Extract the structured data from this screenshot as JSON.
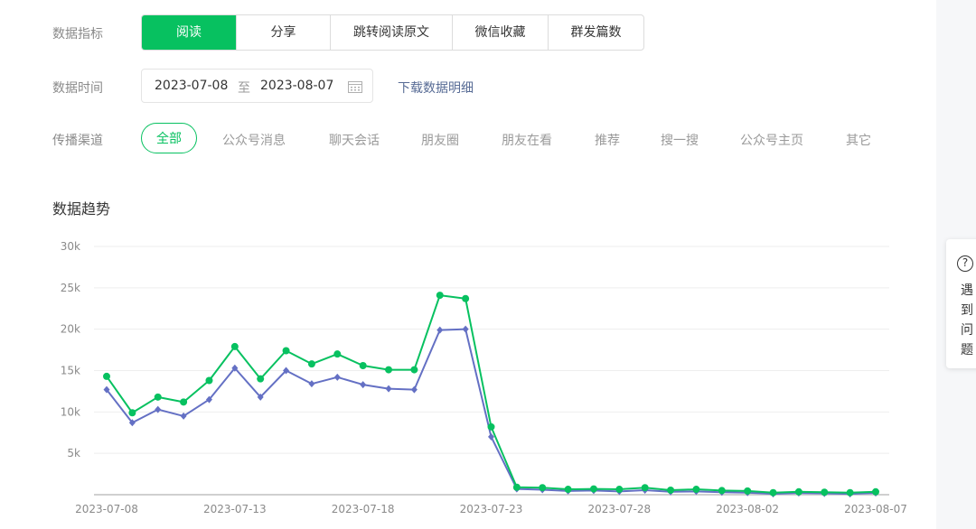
{
  "filters": {
    "metric_label": "数据指标",
    "metrics": [
      "阅读",
      "分享",
      "跳转阅读原文",
      "微信收藏",
      "群发篇数"
    ],
    "active_metric": "阅读",
    "time_label": "数据时间",
    "date_start": "2023-07-08",
    "date_sep": "至",
    "date_end": "2023-08-07",
    "download_link": "下载数据明细",
    "channel_label": "传播渠道",
    "channels": [
      "全部",
      "公众号消息",
      "聊天会话",
      "朋友圈",
      "朋友在看",
      "推荐",
      "搜一搜",
      "公众号主页",
      "其它"
    ],
    "active_channel": "全部"
  },
  "section_title": "数据趋势",
  "help_widget": {
    "text": "遇到问题",
    "icon": "question-circle-icon"
  },
  "colors": {
    "accent": "#07c160",
    "series2": "#6470c4",
    "link": "#576b95"
  },
  "chart_data": {
    "type": "line",
    "x": [
      "2023-07-08",
      "2023-07-09",
      "2023-07-10",
      "2023-07-11",
      "2023-07-12",
      "2023-07-13",
      "2023-07-14",
      "2023-07-15",
      "2023-07-16",
      "2023-07-17",
      "2023-07-18",
      "2023-07-19",
      "2023-07-20",
      "2023-07-21",
      "2023-07-22",
      "2023-07-23",
      "2023-07-24",
      "2023-07-25",
      "2023-07-26",
      "2023-07-27",
      "2023-07-28",
      "2023-07-29",
      "2023-07-30",
      "2023-07-31",
      "2023-08-01",
      "2023-08-02",
      "2023-08-03",
      "2023-08-04",
      "2023-08-05",
      "2023-08-06",
      "2023-08-07"
    ],
    "x_tick_labels": [
      "2023-07-08",
      "2023-07-13",
      "2023-07-18",
      "2023-07-23",
      "2023-07-28",
      "2023-08-02",
      "2023-08-07"
    ],
    "series": [
      {
        "color": "#07c160",
        "marker": "circle",
        "values": [
          14300,
          9900,
          11800,
          11200,
          13800,
          17900,
          14000,
          17400,
          15800,
          17000,
          15600,
          15100,
          15100,
          24100,
          23700,
          8200,
          900,
          850,
          650,
          700,
          650,
          850,
          550,
          650,
          500,
          450,
          250,
          350,
          300,
          250,
          350
        ]
      },
      {
        "color": "#6470c4",
        "marker": "diamond",
        "values": [
          12700,
          8700,
          10300,
          9500,
          11500,
          15300,
          11800,
          15000,
          13400,
          14200,
          13300,
          12800,
          12700,
          19900,
          20000,
          7000,
          700,
          600,
          450,
          500,
          400,
          550,
          350,
          400,
          300,
          250,
          100,
          200,
          150,
          100,
          200
        ]
      }
    ],
    "y_ticks": [
      "5k",
      "10k",
      "15k",
      "20k",
      "25k",
      "30k"
    ],
    "ylim": [
      0,
      30000
    ],
    "grid": true,
    "xlabel": "",
    "ylabel": "",
    "title": ""
  }
}
